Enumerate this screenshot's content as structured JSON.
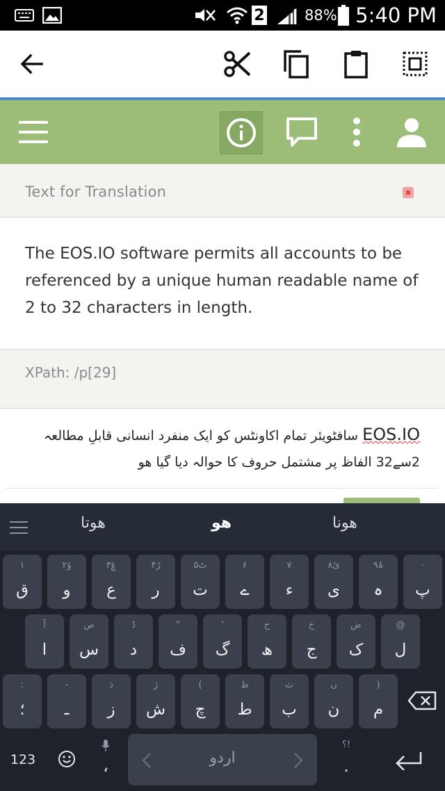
{
  "status_bar": {
    "battery_percent": "88%",
    "time": "5:40 PM",
    "sim_slot": "2",
    "icons": [
      "keyboard-icon",
      "image-icon",
      "mute-icon",
      "wifi-icon",
      "sim-icon",
      "signal-icon",
      "battery-icon"
    ]
  },
  "action_bar": {
    "icons": [
      "back-arrow-icon",
      "cut-icon",
      "copy-icon",
      "paste-icon",
      "select-all-icon"
    ]
  },
  "toolbar": {
    "icons": [
      "menu-icon",
      "info-icon",
      "comment-icon",
      "more-icon",
      "user-icon"
    ],
    "accent_color": "#9bbd77"
  },
  "panel": {
    "title": "Text for Translation",
    "source_text": "The EOS.IO software permits all accounts to be referenced by a unique human readable name of 2 to 32 characters in length.",
    "xpath": "XPath: /p[29]"
  },
  "translation": {
    "misspelled": "EOS.IO",
    "line1_rest": " سافٹویئر تمام اکاونٹس کو ایک منفرد انسانی قابلِ مطالعہ",
    "line2": "2سے32 الفاظ پر مشتمل حروف کا حوالہ دیا گیا ھو"
  },
  "keyboard": {
    "suggestions": [
      "ھوتا",
      "ھو",
      "ھونا"
    ],
    "row1": [
      {
        "main": "ق",
        "hint": "۱"
      },
      {
        "main": "و",
        "hint": "ۇ۲"
      },
      {
        "main": "ع",
        "hint": "ۼ۳"
      },
      {
        "main": "ر",
        "hint": "ڑ۴"
      },
      {
        "main": "ت",
        "hint": "ٹ۵"
      },
      {
        "main": "ے",
        "hint": "۶"
      },
      {
        "main": "ء",
        "hint": "۷"
      },
      {
        "main": "ی",
        "hint": "ئ۸"
      },
      {
        "main": "ہ",
        "hint": "۹ۂ"
      },
      {
        "main": "پ",
        "hint": "۰"
      }
    ],
    "row2": [
      {
        "main": "ا",
        "hint": "آ"
      },
      {
        "main": "س",
        "hint": "ص"
      },
      {
        "main": "د",
        "hint": "ڈ"
      },
      {
        "main": "ف",
        "hint": "\""
      },
      {
        "main": "گ",
        "hint": "'"
      },
      {
        "main": "ھ",
        "hint": "ح"
      },
      {
        "main": "ج",
        "hint": "خ"
      },
      {
        "main": "ک",
        "hint": "ض"
      },
      {
        "main": "ل",
        "hint": "@"
      }
    ],
    "row3": [
      {
        "main": "؛",
        "hint": ":"
      },
      {
        "main": "ـ",
        "hint": "-"
      },
      {
        "main": "ز",
        "hint": "ذ"
      },
      {
        "main": "ش",
        "hint": "ژ"
      },
      {
        "main": "چ",
        "hint": "("
      },
      {
        "main": "ط",
        "hint": "ظ"
      },
      {
        "main": "ب",
        "hint": "ث"
      },
      {
        "main": "ن",
        "hint": "ں"
      },
      {
        "main": "م",
        "hint": ")"
      }
    ],
    "num_label": "123",
    "comma_label": "،",
    "space_label": "اردو",
    "period_label": ".",
    "period_hint": "؟!",
    "icons": [
      "keyboard-menu-icon",
      "backspace-icon",
      "emoji-icon",
      "mic-icon",
      "enter-icon"
    ]
  }
}
